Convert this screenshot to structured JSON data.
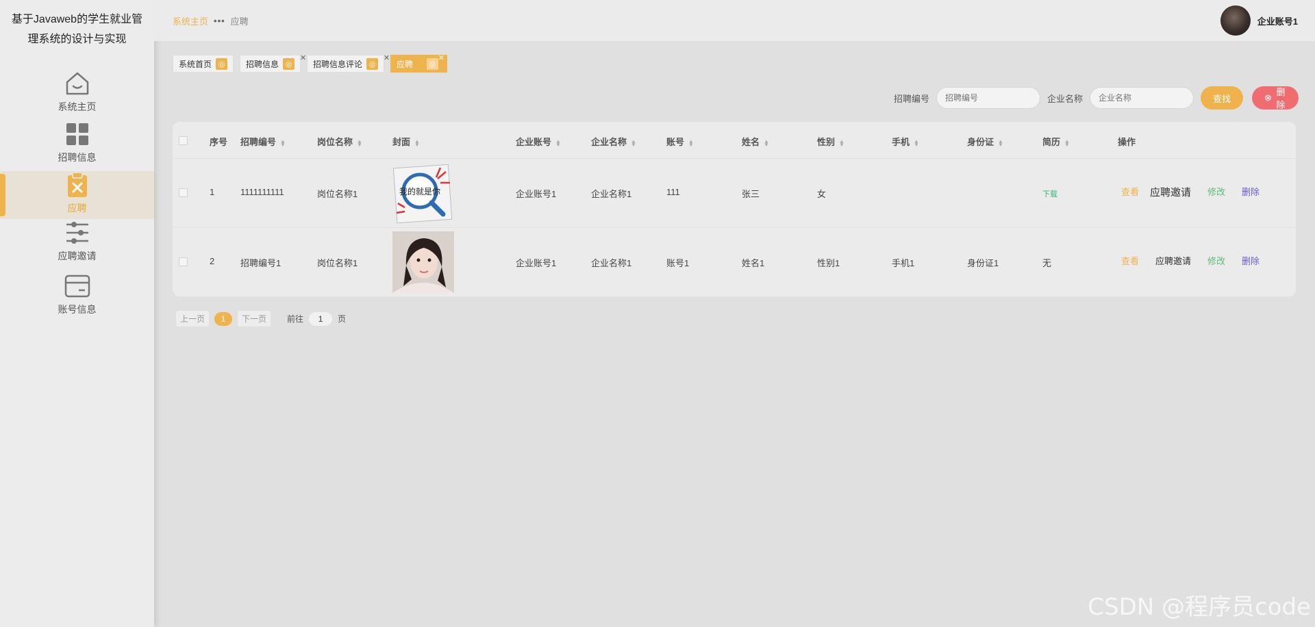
{
  "app": {
    "title": "基于Javaweb的学生就业管理系统的设计与实现"
  },
  "sidebar": {
    "items": [
      {
        "label": "系统主页",
        "icon": "home-icon"
      },
      {
        "label": "招聘信息",
        "icon": "grid-icon"
      },
      {
        "label": "应聘",
        "icon": "clipboard-x-icon",
        "active": true
      },
      {
        "label": "应聘邀请",
        "icon": "sliders-icon"
      },
      {
        "label": "账号信息",
        "icon": "card-icon"
      }
    ]
  },
  "header": {
    "breadcrumb_home": "系统主页",
    "breadcrumb_sep": "•••",
    "breadcrumb_current": "应聘",
    "user_name": "企业账号1"
  },
  "tabs": [
    {
      "label": "系统首页",
      "closable": false
    },
    {
      "label": "招聘信息",
      "closable": true
    },
    {
      "label": "招聘信息评论",
      "closable": true
    },
    {
      "label": "应聘",
      "closable": true,
      "active": true
    }
  ],
  "search": {
    "field1_label": "招聘编号",
    "field1_placeholder": "招聘编号",
    "field2_label": "企业名称",
    "field2_placeholder": "企业名称",
    "search_button": "查找",
    "delete_button": "删除"
  },
  "table": {
    "columns": [
      "序号",
      "招聘编号",
      "岗位名称",
      "封面",
      "企业账号",
      "企业名称",
      "账号",
      "姓名",
      "性别",
      "手机",
      "身份证",
      "简历",
      "操作"
    ],
    "rows": [
      {
        "index": "1",
        "recruit_no": "1111111111",
        "position": "岗位名称1",
        "company_account": "企业账号1",
        "company_name": "企业名称1",
        "account": "111",
        "name": "张三",
        "gender": "女",
        "phone": "",
        "id_card": "",
        "resume": "下载"
      },
      {
        "index": "2",
        "recruit_no": "招聘编号1",
        "position": "岗位名称1",
        "company_account": "企业账号1",
        "company_name": "企业名称1",
        "account": "账号1",
        "name": "姓名1",
        "gender": "性别1",
        "phone": "手机1",
        "id_card": "身份证1",
        "resume": "无"
      }
    ],
    "actions": {
      "view": "查看",
      "invite": "应聘邀请",
      "edit": "修改",
      "delete": "删除"
    },
    "cover1_text": "我的就是你"
  },
  "pager": {
    "prev": "上一页",
    "current": "1",
    "next": "下一页",
    "goto_label": "前往",
    "goto_value": "1",
    "goto_suffix": "页"
  },
  "watermark": "CSDN @程序员code",
  "colors": {
    "accent": "#efb34d",
    "danger": "#ef6d70",
    "edit": "#5dbb7a",
    "delete_link": "#6a5ce0"
  }
}
